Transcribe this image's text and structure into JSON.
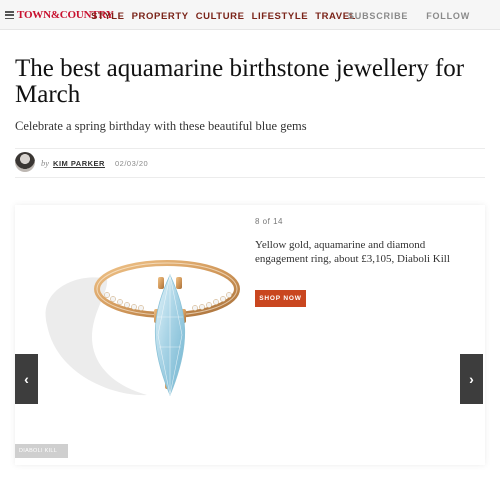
{
  "nav": {
    "logo": "TOWN&COUNTRY",
    "items": [
      "STYLE",
      "PROPERTY",
      "CULTURE",
      "LIFESTYLE",
      "TRAVEL"
    ],
    "subscribe": "SUBSCRIBE",
    "follow": "FOLLOW"
  },
  "article": {
    "headline": "The best aquamarine birthstone jewellery for March",
    "dek": "Celebrate a spring birthday with these beautiful blue gems",
    "by": "by",
    "author": "KIM PARKER",
    "date": "02/03/20"
  },
  "slideshow": {
    "counter": "8 of 14",
    "caption": "Yellow gold, aquamarine and diamond engagement ring, about £3,105, Diaboli Kill",
    "shop_label": "SHOP NOW",
    "credit": "DIABOLI KILL",
    "prev_glyph": "‹",
    "next_glyph": "›"
  },
  "colors": {
    "logo_red": "#c8102e",
    "nav_brown": "#7a2318",
    "shop_orange": "#c9461f",
    "gem_blue": "#a9d4e6",
    "gold": "#d39a5c"
  }
}
